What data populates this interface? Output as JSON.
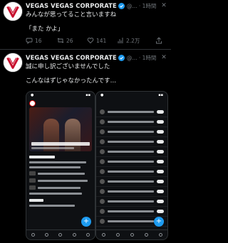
{
  "post1": {
    "display_name": "VEGAS VEGAS CORPORATE",
    "handle_time": "@... · 1時間",
    "text": "みんなが思ってること言いますね",
    "quote": "「また かよ」",
    "actions": {
      "replies": "16",
      "retweets": "26",
      "likes": "141",
      "views": "2.2万"
    }
  },
  "post2": {
    "display_name": "VEGAS VEGAS CORPORATE",
    "handle_time": "@... · 1時間",
    "line1": "誠に申し訳ございませんでした",
    "line2": "こんなはずじゃなかったんです…"
  },
  "colors": {
    "background": "#000000",
    "text": "#e7e9ea",
    "muted": "#71767b",
    "verified": "#1d9bf0",
    "divider": "#2f3336"
  },
  "icons": [
    "verified-badge-icon",
    "more-icon",
    "reply-icon",
    "retweet-icon",
    "like-icon",
    "views-icon",
    "share-icon"
  ]
}
